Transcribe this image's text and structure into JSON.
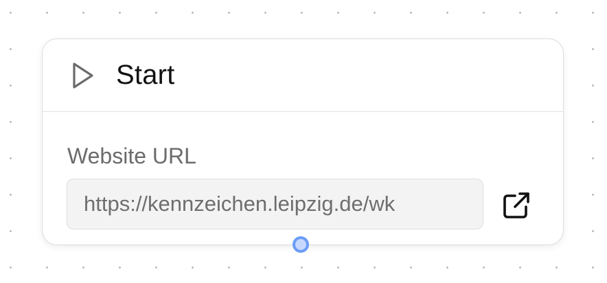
{
  "node": {
    "title": "Start",
    "icon": "play-icon",
    "field": {
      "label": "Website URL",
      "value": "https://kennzeichen.leipzig.de/wk"
    },
    "open_link_icon": "external-link-icon"
  },
  "colors": {
    "handle_fill": "#c7d8ff",
    "handle_border": "#6b9df5",
    "input_background": "#f3f3f3",
    "canvas_dots": "#b9b9b9"
  }
}
